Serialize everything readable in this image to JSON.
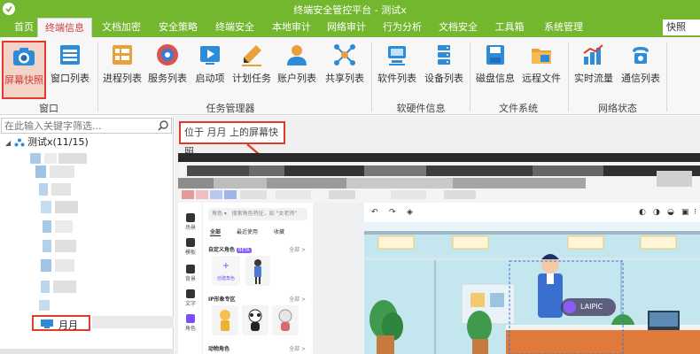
{
  "window": {
    "title": "终端安全管控平台 - 测试x"
  },
  "menu": {
    "items": [
      {
        "label": "首页"
      },
      {
        "label": "终端信息"
      },
      {
        "label": "文档加密"
      },
      {
        "label": "安全策略"
      },
      {
        "label": "终端安全"
      },
      {
        "label": "本地审计"
      },
      {
        "label": "网络审计"
      },
      {
        "label": "行为分析"
      },
      {
        "label": "文档安全"
      },
      {
        "label": "工具箱"
      },
      {
        "label": "系统管理"
      }
    ],
    "active_index": 1,
    "right_label": "快照"
  },
  "ribbon": {
    "buttons": [
      {
        "label": "屏幕快照",
        "icon": "camera-icon"
      },
      {
        "label": "窗口列表",
        "icon": "window-list-icon"
      },
      {
        "label": "进程列表",
        "icon": "process-list-icon"
      },
      {
        "label": "服务列表",
        "icon": "service-list-icon"
      },
      {
        "label": "启动项",
        "icon": "startup-icon"
      },
      {
        "label": "计划任务",
        "icon": "scheduled-task-icon"
      },
      {
        "label": "账户列表",
        "icon": "account-list-icon"
      },
      {
        "label": "共享列表",
        "icon": "share-list-icon"
      },
      {
        "label": "软件列表",
        "icon": "software-list-icon"
      },
      {
        "label": "设备列表",
        "icon": "device-list-icon"
      },
      {
        "label": "磁盘信息",
        "icon": "disk-icon"
      },
      {
        "label": "远程文件",
        "icon": "remote-file-icon"
      },
      {
        "label": "实时流量",
        "icon": "traffic-icon"
      },
      {
        "label": "通信列表",
        "icon": "phone-icon"
      }
    ],
    "groups": [
      {
        "label": "窗口"
      },
      {
        "label": "任务管理器"
      },
      {
        "label": "软硬件信息"
      },
      {
        "label": "文件系统"
      },
      {
        "label": "网络状态"
      }
    ]
  },
  "tree": {
    "search_placeholder": "在此输入关键字筛选...",
    "root_label": "测试x(11/15)",
    "selected_node": "月月"
  },
  "viewer": {
    "path_label": "位于 月月 上的屏幕快照",
    "shot": {
      "rail": [
        "场景",
        "模板",
        "背景",
        "文字",
        "角色"
      ],
      "search_placeholder": "搜索角色特征，如 \"女老师\"",
      "role_dropdown": "角色",
      "tabs": [
        "全部",
        "最近使用",
        "收藏"
      ],
      "sections": [
        "自定义角色",
        "IP形象专区",
        "动物角色"
      ],
      "badge": "BETA",
      "all_link": "全部 >",
      "create_label": "创建角色",
      "watermark": "LAIPIC"
    }
  },
  "colors": {
    "brand_green": "#73b72f",
    "highlight_red": "#e13b2b"
  }
}
